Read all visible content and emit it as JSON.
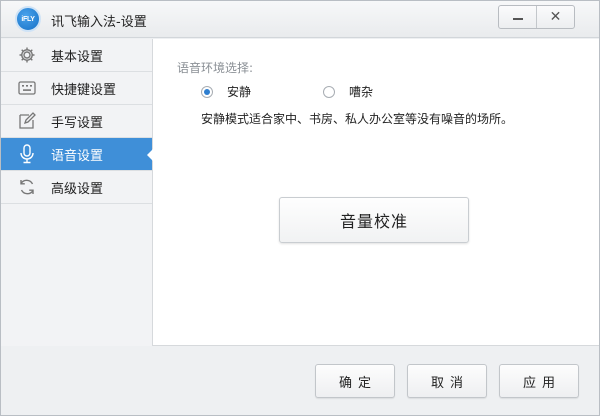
{
  "window": {
    "title": "讯飞输入法-设置",
    "logo_text": "iFLY",
    "minimize_icon": "minimize-icon",
    "close_icon": "close-icon",
    "close_glyph": "✕"
  },
  "sidebar": {
    "active_index": 3,
    "accent_color": "#3f8fd8",
    "items": [
      {
        "label": "基本设置",
        "icon": "gear-icon"
      },
      {
        "label": "快捷键设置",
        "icon": "keyboard-icon"
      },
      {
        "label": "手写设置",
        "icon": "pen-icon"
      },
      {
        "label": "语音设置",
        "icon": "microphone-icon"
      },
      {
        "label": "高级设置",
        "icon": "refresh-icon"
      }
    ]
  },
  "main": {
    "section_label": "语音环境选择:",
    "options": [
      {
        "label": "安静",
        "checked": true
      },
      {
        "label": "嘈杂",
        "checked": false
      }
    ],
    "description": "安静模式适合家中、书房、私人办公室等没有噪音的场所。",
    "calibrate_button": "音量校准"
  },
  "footer": {
    "ok": "确定",
    "cancel": "取消",
    "apply": "应用"
  }
}
